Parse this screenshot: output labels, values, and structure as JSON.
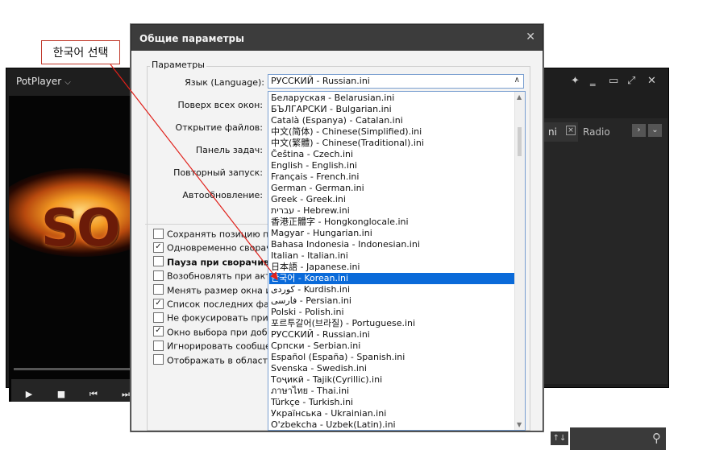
{
  "annotation": {
    "text": "한국어 선택"
  },
  "player": {
    "title": "PotPlayer",
    "video_text": "SO",
    "playlist_tab": "ni",
    "radio_tab": "Radio",
    "controls": [
      "play-icon",
      "stop-icon",
      "prev-icon",
      "next-icon"
    ],
    "window_controls": [
      "pin-icon",
      "minimize-icon",
      "maximize-icon",
      "fullscreen-icon",
      "close-icon"
    ]
  },
  "dialog": {
    "title": "Общие параметры",
    "group_label": "Параметры",
    "labels": {
      "language": "Язык (Language):",
      "on_top": "Поверх всех окон:",
      "open_files": "Открытие файлов:",
      "taskbar": "Панель задач:",
      "restart": "Повторный запуск:",
      "autoupdate": "Автообновление:"
    },
    "language_select": {
      "value": "РУССКИЙ - Russian.ini"
    },
    "checkboxes": [
      {
        "label": "Сохранять позицию пр",
        "checked": false,
        "bold": false
      },
      {
        "label": "Одновременно сворач",
        "checked": true,
        "bold": false
      },
      {
        "label": "Пауза при сворачив",
        "checked": false,
        "bold": true
      },
      {
        "label": "Возобновлять при акт",
        "checked": false,
        "bold": false
      },
      {
        "label": "Менять размер окна и",
        "checked": false,
        "bold": false
      },
      {
        "label": "Список последних фа",
        "checked": true,
        "bold": false
      },
      {
        "label": "Не фокусировать при",
        "checked": false,
        "bold": false
      },
      {
        "label": "Окно выбора при доба",
        "checked": true,
        "bold": false
      },
      {
        "label": "Игнорировать сообще",
        "checked": false,
        "bold": false
      },
      {
        "label": "Отображать в област",
        "checked": false,
        "bold": false
      }
    ]
  },
  "dropdown": {
    "selected": "한국어 - Korean.ini",
    "items": [
      "Беларуская - Belarusian.ini",
      "БЪЛГАРСКИ - Bulgarian.ini",
      "Català (Espanya) - Catalan.ini",
      "中文(简体) - Chinese(Simplified).ini",
      "中文(繁體) - Chinese(Traditional).ini",
      "Čeština - Czech.ini",
      "English - English.ini",
      "Français - French.ini",
      "German - German.ini",
      "Greek - Greek.ini",
      "עברית - Hebrew.ini",
      "香港正體字 - Hongkonglocale.ini",
      "Magyar - Hungarian.ini",
      "Bahasa Indonesia - Indonesian.ini",
      "Italian - Italian.ini",
      "日本語 - Japanese.ini",
      "한국어 - Korean.ini",
      "کوردی - Kurdish.ini",
      "فارسی - Persian.ini",
      "Polski - Polish.ini",
      "포르투갈어(브라질) - Portuguese.ini",
      "РУССКИЙ - Russian.ini",
      "Српски - Serbian.ini",
      "Español (España) - Spanish.ini",
      "Svenska - Swedish.ini",
      "Тоҷикӣ - Tajik(Cyrillic).ini",
      "ภาษาไทย - Thai.ini",
      "Türkçe - Turkish.ini",
      "Українська - Ukrainian.ini",
      "O'zbekcha - Uzbek(Latin).ini"
    ]
  },
  "colors": {
    "selection": "#0a6ad9",
    "annotation_border": "#c0392b",
    "arrow": "#e0201a"
  }
}
